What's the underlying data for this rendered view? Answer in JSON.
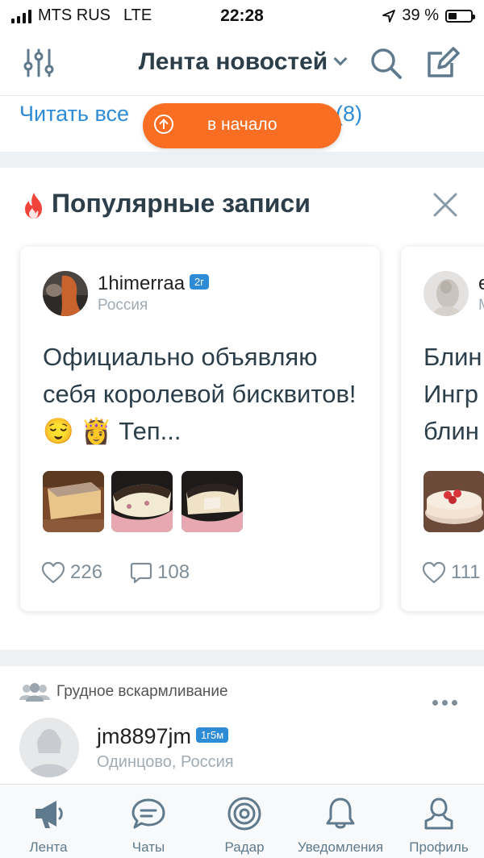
{
  "status_bar": {
    "carrier": "MTS RUS",
    "network": "LTE",
    "time": "22:28",
    "battery": "39 %",
    "battery_level": 0.39
  },
  "header": {
    "title": "Лента новостей"
  },
  "notice": {
    "read_all": "Читать все",
    "count": "(8)",
    "to_top": "в начало"
  },
  "popular": {
    "title": "Популярные записи",
    "cards": [
      {
        "username": "1himerraa",
        "badge": "2г",
        "location": "Россия",
        "text": "Официально объявляю себя королевой бисквитов! 😌 👸 Теп...",
        "likes": "226",
        "comments": "108"
      },
      {
        "username": "e",
        "location": "М",
        "text": "Блин Ингр блин",
        "likes": "111"
      }
    ]
  },
  "post": {
    "group": "Грудное вскармливание",
    "username": "jm8897jm",
    "badge": "1г5м",
    "location": "Одинцово, Россия"
  },
  "tabs": [
    {
      "label": "Лента",
      "icon": "megaphone-icon",
      "active": true
    },
    {
      "label": "Чаты",
      "icon": "chat-bubble-icon"
    },
    {
      "label": "Радар",
      "icon": "radar-icon"
    },
    {
      "label": "Уведомления",
      "icon": "bell-icon"
    },
    {
      "label": "Профиль",
      "icon": "profile-icon"
    }
  ],
  "colors": {
    "accent": "#2e8bd6",
    "orange": "#fa6e24",
    "fire": "#f0433a",
    "text": "#2c3e4a",
    "icon": "#5f7a8c"
  }
}
